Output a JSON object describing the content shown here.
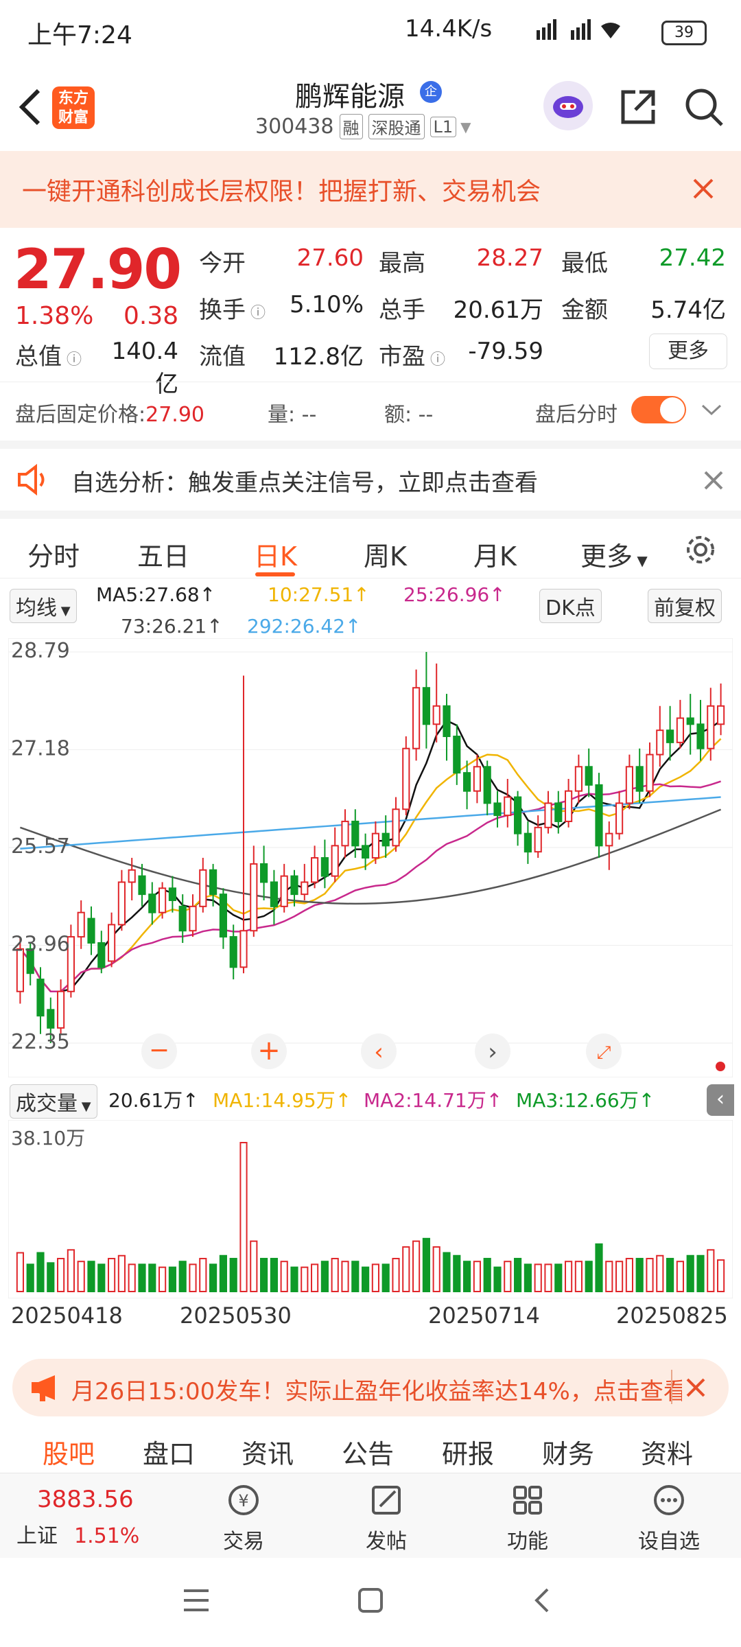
{
  "status": {
    "time": "上午7:24",
    "speed": "14.4K/s",
    "battery": "39"
  },
  "header": {
    "logo_text": "东方\n财富",
    "stock_name": "鹏辉能源",
    "corp_badge": "企",
    "code": "300438",
    "tags": [
      "融",
      "深股通",
      "L1"
    ]
  },
  "banner": {
    "text": "一键开通科创成长层权限！把握打新、交易机会"
  },
  "quote": {
    "price": "27.90",
    "change_pct": "1.38%",
    "change_amt": "0.38",
    "fields": [
      {
        "label": "今开",
        "value": "27.60",
        "color": "red"
      },
      {
        "label": "最高",
        "value": "28.27",
        "color": "red"
      },
      {
        "label": "最低",
        "value": "27.42",
        "color": "green"
      },
      {
        "label": "换手",
        "value": "5.10%",
        "color": "black"
      },
      {
        "label": "总手",
        "value": "20.61万",
        "color": "black"
      },
      {
        "label": "金额",
        "value": "5.74亿",
        "color": "black"
      },
      {
        "label": "总值",
        "value": "140.4亿",
        "color": "black"
      },
      {
        "label": "流值",
        "value": "112.8亿",
        "color": "black"
      },
      {
        "label": "市盈",
        "value": "-79.59",
        "color": "black"
      }
    ],
    "more": "更多"
  },
  "afterhours": {
    "fixed_label": "盘后固定价格:",
    "fixed_value": "27.90",
    "vol_label": "量:",
    "vol_value": "--",
    "amt_label": "额:",
    "amt_value": "--",
    "fenshi_label": "盘后分时"
  },
  "analysis": {
    "text": "自选分析：触发重点关注信号，立即点击查看"
  },
  "chart_tabs": [
    "分时",
    "五日",
    "日K",
    "周K",
    "月K",
    "更多"
  ],
  "ma_legend": {
    "selector": "均线",
    "ma5": "MA5:27.68",
    "ma10": "10:27.51",
    "ma25": "25:26.96",
    "ma73": "73:26.21",
    "ma292": "292:26.42",
    "dk": "DK点",
    "fq": "前复权"
  },
  "chart_data": {
    "type": "candlestick",
    "y_ticks": [
      "28.79",
      "27.18",
      "25.57",
      "23.96",
      "22.35"
    ],
    "ylim": [
      22.35,
      28.79
    ],
    "x_ticks": [
      "20250418",
      "20250530",
      "20250714",
      "20250825"
    ],
    "candles": [
      [
        23.2,
        23.9,
        23.0,
        24.1
      ],
      [
        23.9,
        23.5,
        23.3,
        24.0
      ],
      [
        23.4,
        22.8,
        22.5,
        23.6
      ],
      [
        22.9,
        22.6,
        22.35,
        23.1
      ],
      [
        22.6,
        23.2,
        22.5,
        23.4
      ],
      [
        23.2,
        24.1,
        23.1,
        24.3
      ],
      [
        24.1,
        24.5,
        23.9,
        24.7
      ],
      [
        24.4,
        24.0,
        23.8,
        24.6
      ],
      [
        24.0,
        23.6,
        23.5,
        24.2
      ],
      [
        23.7,
        24.3,
        23.6,
        24.5
      ],
      [
        24.3,
        25.0,
        24.2,
        25.2
      ],
      [
        25.0,
        25.2,
        24.7,
        25.4
      ],
      [
        25.1,
        24.8,
        24.6,
        25.3
      ],
      [
        24.8,
        24.5,
        24.3,
        25.0
      ],
      [
        24.5,
        24.9,
        24.4,
        25.0
      ],
      [
        24.9,
        24.7,
        24.5,
        25.1
      ],
      [
        24.6,
        24.2,
        24.0,
        24.8
      ],
      [
        24.2,
        24.6,
        24.1,
        24.8
      ],
      [
        24.6,
        25.2,
        24.5,
        25.4
      ],
      [
        25.2,
        24.8,
        24.6,
        25.3
      ],
      [
        24.8,
        24.1,
        23.9,
        24.9
      ],
      [
        24.1,
        23.6,
        23.4,
        24.3
      ],
      [
        23.6,
        24.2,
        23.5,
        28.4
      ],
      [
        24.2,
        25.3,
        24.1,
        25.6
      ],
      [
        25.3,
        25.0,
        24.7,
        25.6
      ],
      [
        25.0,
        24.6,
        24.3,
        25.2
      ],
      [
        24.6,
        25.1,
        24.5,
        25.3
      ],
      [
        25.1,
        24.8,
        24.6,
        25.2
      ],
      [
        24.8,
        25.0,
        24.7,
        25.3
      ],
      [
        25.0,
        25.4,
        24.9,
        25.6
      ],
      [
        25.4,
        25.1,
        24.9,
        25.7
      ],
      [
        25.1,
        25.6,
        25.0,
        25.9
      ],
      [
        25.6,
        26.0,
        25.4,
        26.2
      ],
      [
        26.0,
        25.6,
        25.4,
        26.2
      ],
      [
        25.6,
        25.4,
        25.2,
        25.8
      ],
      [
        25.4,
        25.8,
        25.3,
        26.0
      ],
      [
        25.8,
        25.6,
        25.4,
        26.1
      ],
      [
        25.6,
        26.2,
        25.5,
        26.4
      ],
      [
        26.2,
        27.2,
        26.1,
        27.4
      ],
      [
        27.2,
        28.2,
        27.0,
        28.5
      ],
      [
        28.2,
        27.6,
        27.2,
        28.79
      ],
      [
        27.6,
        27.9,
        27.3,
        28.6
      ],
      [
        27.9,
        27.4,
        27.0,
        28.1
      ],
      [
        27.4,
        26.8,
        26.6,
        27.6
      ],
      [
        26.8,
        26.5,
        26.2,
        27.0
      ],
      [
        26.5,
        26.9,
        26.3,
        27.1
      ],
      [
        26.9,
        26.3,
        26.1,
        27.0
      ],
      [
        26.3,
        26.1,
        25.9,
        26.5
      ],
      [
        26.1,
        26.4,
        25.9,
        26.7
      ],
      [
        26.4,
        25.8,
        25.6,
        26.5
      ],
      [
        25.8,
        25.5,
        25.3,
        26.0
      ],
      [
        25.5,
        25.9,
        25.4,
        26.1
      ],
      [
        25.9,
        26.3,
        25.8,
        26.5
      ],
      [
        26.3,
        26.0,
        25.8,
        26.5
      ],
      [
        26.0,
        26.5,
        25.9,
        26.7
      ],
      [
        26.5,
        26.9,
        26.3,
        27.1
      ],
      [
        26.9,
        26.6,
        26.4,
        27.2
      ],
      [
        26.6,
        25.6,
        25.4,
        26.8
      ],
      [
        25.6,
        25.8,
        25.2,
        26.0
      ],
      [
        25.8,
        26.3,
        25.7,
        26.5
      ],
      [
        26.3,
        26.9,
        26.2,
        27.1
      ],
      [
        26.9,
        26.5,
        26.3,
        27.2
      ],
      [
        26.5,
        27.1,
        26.4,
        27.3
      ],
      [
        27.1,
        27.5,
        26.9,
        27.9
      ],
      [
        27.5,
        27.3,
        27.0,
        27.9
      ],
      [
        27.3,
        27.7,
        27.2,
        28.0
      ],
      [
        27.7,
        27.6,
        27.1,
        28.1
      ],
      [
        27.6,
        27.2,
        27.0,
        28.0
      ],
      [
        27.2,
        27.9,
        27.0,
        28.2
      ],
      [
        27.6,
        27.9,
        27.42,
        28.27
      ]
    ]
  },
  "vol_legend": {
    "selector": "成交量",
    "vol": "20.61万",
    "ma1": "MA1:14.95万",
    "ma2": "MA2:14.71万",
    "ma3": "MA3:12.66万",
    "max_label": "38.10万"
  },
  "notice": {
    "text": "月26日15:00发车！实际止盈年化收益率达14%，点击查看"
  },
  "bottom_tabs": [
    "股吧",
    "盘口",
    "资讯",
    "公告",
    "研报",
    "财务",
    "资料"
  ],
  "bottombar": {
    "index_value": "3883.56",
    "index_name": "上证",
    "index_pct": "1.51%",
    "items": [
      "交易",
      "发帖",
      "功能",
      "设自选"
    ]
  },
  "colors": {
    "accent": "#ff5a1f",
    "up": "#e0262a",
    "down": "#0e9a28"
  }
}
